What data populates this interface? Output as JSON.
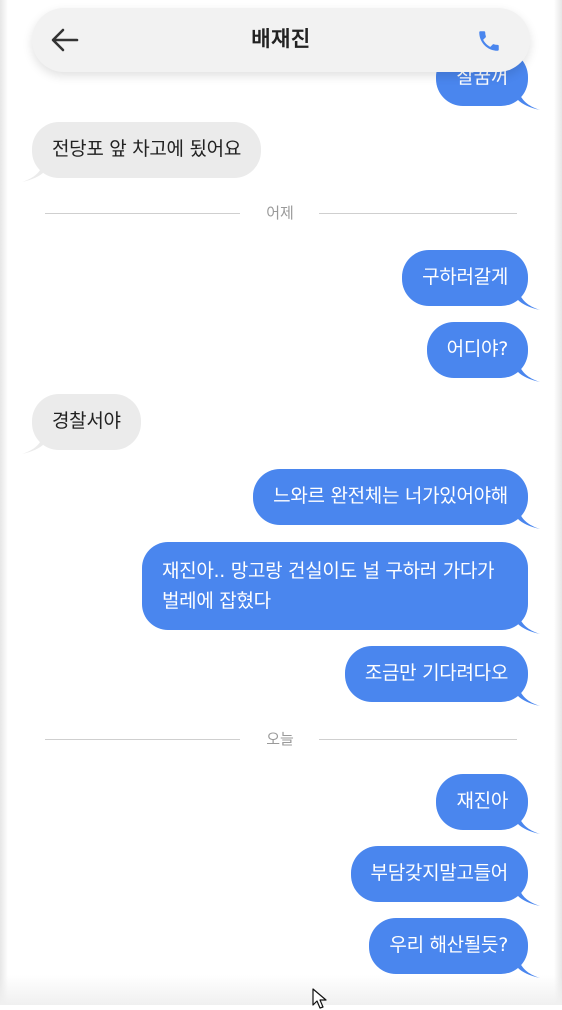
{
  "header": {
    "title": "배재진",
    "back_icon": "arrow-left-icon",
    "call_icon": "phone-icon",
    "accent_color": "#4a86ee"
  },
  "messages": [
    {
      "dir": "out",
      "text": "잘꿈꺼"
    },
    {
      "dir": "in",
      "text": "전당포 앞 차고에 됬어요"
    },
    {
      "sep": "어제"
    },
    {
      "dir": "out",
      "text": "구하러갈게"
    },
    {
      "dir": "out",
      "text": "어디야?"
    },
    {
      "dir": "in",
      "text": "경찰서야"
    },
    {
      "dir": "out",
      "text": "느와르 완전체는 너가있어야해"
    },
    {
      "dir": "out",
      "text": "재진아.. 망고랑 건실이도 널 구하러 가다가 벌레에 잡혔다"
    },
    {
      "dir": "out",
      "text": "조금만 기다려다오"
    },
    {
      "sep": "오늘"
    },
    {
      "dir": "out",
      "text": "재진아"
    },
    {
      "dir": "out",
      "text": "부담갖지말고들어"
    },
    {
      "dir": "out",
      "text": "우리 해산될듯?"
    }
  ],
  "colors": {
    "outgoing_bubble": "#4a86ee",
    "incoming_bubble": "#ebebeb",
    "separator_text": "#9a9a9a"
  }
}
